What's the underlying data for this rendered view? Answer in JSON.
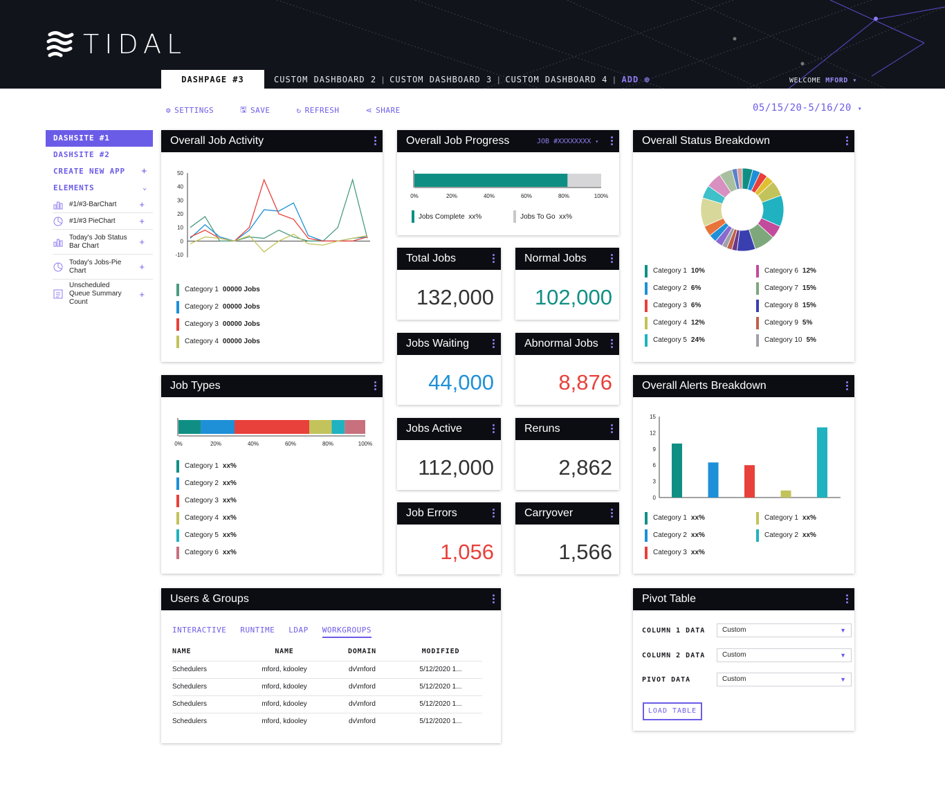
{
  "app": {
    "brand": "TIDAL",
    "accent": "#6b5ce7"
  },
  "tabs": {
    "active": "DASHPAGE #3",
    "items": [
      "CUSTOM DASHBOARD 2",
      "CUSTOM DASHBOARD 3",
      "CUSTOM DASHBOARD 4"
    ],
    "add": "ADD"
  },
  "user": {
    "welcome": "WELCOME",
    "name": "MFORD"
  },
  "toolbar": {
    "settings": "SETTINGS",
    "save": "SAVE",
    "refresh": "REFRESH",
    "share": "SHARE"
  },
  "date_range": "05/15/20-5/16/20",
  "sidebar": {
    "items": [
      "DASHSITE #1",
      "DASHSITE #2",
      "CREATE NEW APP",
      "ELEMENTS"
    ],
    "elements": [
      "#1/#3-BarChart",
      "#1/#3 PieChart",
      "Today's Job Status Bar Chart",
      "Today's Jobs-Pie Chart",
      "Unscheduled Queue Summary Count"
    ]
  },
  "cards": {
    "activity": {
      "title": "Overall Job Activity",
      "legend": [
        {
          "label": "Category 1",
          "value": "00000 Jobs"
        },
        {
          "label": "Category 2",
          "value": "00000 Jobs"
        },
        {
          "label": "Category 3",
          "value": "00000 Jobs"
        },
        {
          "label": "Category 4",
          "value": "00000 Jobs"
        }
      ]
    },
    "progress": {
      "title": "Overall Job Progress",
      "job": "JOB #XXXXXXXX",
      "complete_label": "Jobs Complete",
      "complete_value": "xx%",
      "togo_label": "Jobs To Go",
      "togo_value": "xx%"
    },
    "status": {
      "title": "Overall Status Breakdown"
    },
    "types": {
      "title": "Job Types",
      "legend": [
        {
          "label": "Category 1",
          "value": "xx%"
        },
        {
          "label": "Category 2",
          "value": "xx%"
        },
        {
          "label": "Category 3",
          "value": "xx%"
        },
        {
          "label": "Category 4",
          "value": "xx%"
        },
        {
          "label": "Category 5",
          "value": "xx%"
        },
        {
          "label": "Category 6",
          "value": "xx%"
        }
      ]
    },
    "alerts": {
      "title": "Overall Alerts Breakdown",
      "legend": [
        {
          "label": "Category 1",
          "value": "xx%"
        },
        {
          "label": "Category 2",
          "value": "xx%"
        },
        {
          "label": "Category 3",
          "value": "xx%"
        },
        {
          "label": "Category 1",
          "value": "xx%"
        },
        {
          "label": "Category 2",
          "value": "xx%"
        }
      ]
    },
    "users": {
      "title": "Users & Groups",
      "tabs": [
        "INTERACTIVE",
        "RUNTIME",
        "LDAP",
        "WORKGROUPS"
      ],
      "columns": [
        "NAME",
        "NAME",
        "DOMAIN",
        "MODIFIED"
      ],
      "rows": [
        [
          "Schedulers",
          "mford, kdooley",
          "dv\\mford",
          "5/12/2020 1..."
        ],
        [
          "Schedulers",
          "mford, kdooley",
          "dv\\mford",
          "5/12/2020 1..."
        ],
        [
          "Schedulers",
          "mford, kdooley",
          "dv\\mford",
          "5/12/2020 1..."
        ],
        [
          "Schedulers",
          "mford, kdooley",
          "dv\\mford",
          "5/12/2020 1..."
        ]
      ]
    },
    "pivot": {
      "title": "Pivot Table",
      "rows": [
        {
          "label": "COLUMN 1 DATA",
          "value": "Custom"
        },
        {
          "label": "COLUMN 2 DATA",
          "value": "Custom"
        },
        {
          "label": "PIVOT DATA",
          "value": "Custom"
        }
      ],
      "button": "LOAD TABLE"
    }
  },
  "stats": [
    {
      "title": "Total Jobs",
      "value": "132,000",
      "color": "#333333"
    },
    {
      "title": "Normal Jobs",
      "value": "102,000",
      "color": "#0f8f84"
    },
    {
      "title": "Jobs Waiting",
      "value": "44,000",
      "color": "#1e90d8"
    },
    {
      "title": "Abnormal Jobs",
      "value": "8,876",
      "color": "#e8403a"
    },
    {
      "title": "Jobs Active",
      "value": "112,000",
      "color": "#333333"
    },
    {
      "title": "Reruns",
      "value": "2,862",
      "color": "#333333"
    },
    {
      "title": "Job Errors",
      "value": "1,056",
      "color": "#e8403a"
    },
    {
      "title": "Carryover",
      "value": "1,566",
      "color": "#333333"
    }
  ],
  "chart_data": [
    {
      "type": "line",
      "x": [
        1,
        2,
        3,
        4,
        5,
        6,
        7,
        8,
        9,
        10,
        11,
        12,
        13
      ],
      "ylim": [
        -10,
        50
      ],
      "yticks": [
        50,
        40,
        30,
        20,
        10,
        0,
        -10
      ],
      "series": [
        {
          "name": "Category 1",
          "color": "#4a9c80",
          "values": [
            10,
            18,
            0,
            0,
            3,
            2,
            8,
            3,
            0,
            0,
            10,
            45,
            2
          ]
        },
        {
          "name": "Category 2",
          "color": "#1e90d8",
          "values": [
            2,
            12,
            3,
            0,
            8,
            23,
            22,
            28,
            4,
            0,
            0,
            2,
            3
          ]
        },
        {
          "name": "Category 3",
          "color": "#e8403a",
          "values": [
            3,
            8,
            2,
            0,
            10,
            45,
            20,
            16,
            2,
            0,
            0,
            0,
            3
          ]
        },
        {
          "name": "Category 4",
          "color": "#c2c35a",
          "values": [
            -2,
            3,
            2,
            0,
            4,
            -8,
            0,
            5,
            -2,
            -3,
            0,
            2,
            4
          ]
        }
      ]
    },
    {
      "type": "bar",
      "orientation": "horizontal",
      "stacked": true,
      "xticks": [
        "0%",
        "20%",
        "40%",
        "60%",
        "80%",
        "100%"
      ],
      "series": [
        {
          "name": "Jobs Complete",
          "color": "#0f8f84",
          "values": [
            82
          ]
        },
        {
          "name": "Jobs To Go",
          "color": "#d6d6d8",
          "values": [
            18
          ]
        }
      ]
    },
    {
      "type": "pie",
      "donut": true,
      "legend": [
        {
          "label": "Category 1",
          "value": "10%",
          "color": "#0f8f84"
        },
        {
          "label": "Category 2",
          "value": "6%",
          "color": "#1e90d8"
        },
        {
          "label": "Category 3",
          "value": "6%",
          "color": "#e8403a"
        },
        {
          "label": "Category 4",
          "value": "12%",
          "color": "#c2c35a"
        },
        {
          "label": "Category 5",
          "value": "24%",
          "color": "#20b2c0"
        },
        {
          "label": "Category 6",
          "value": "12%",
          "color": "#c24b9c"
        },
        {
          "label": "Category 7",
          "value": "15%",
          "color": "#7ea87c"
        },
        {
          "label": "Category 8",
          "value": "15%",
          "color": "#3a3fb0"
        },
        {
          "label": "Category 9",
          "value": "5%",
          "color": "#c0604a"
        },
        {
          "label": "Category 10",
          "value": "5%",
          "color": "#a0a0a8"
        }
      ],
      "slices": [
        {
          "value": 4,
          "color": "#0f8f84"
        },
        {
          "value": 3,
          "color": "#1e90d8"
        },
        {
          "value": 3,
          "color": "#e8403a"
        },
        {
          "value": 3,
          "color": "#e0c030"
        },
        {
          "value": 6,
          "color": "#c2c35a"
        },
        {
          "value": 12,
          "color": "#20b2c0"
        },
        {
          "value": 5,
          "color": "#c24b9c"
        },
        {
          "value": 8,
          "color": "#7ea87c"
        },
        {
          "value": 7,
          "color": "#3a3fb0"
        },
        {
          "value": 2,
          "color": "#6a3a8a"
        },
        {
          "value": 2,
          "color": "#c0604a"
        },
        {
          "value": 2,
          "color": "#a0a0a8"
        },
        {
          "value": 3,
          "color": "#8a6ad0"
        },
        {
          "value": 3,
          "color": "#1e90d8"
        },
        {
          "value": 4,
          "color": "#e8743a"
        },
        {
          "value": 11,
          "color": "#d8d89a"
        },
        {
          "value": 5,
          "color": "#40c0c8"
        },
        {
          "value": 6,
          "color": "#d890c0"
        },
        {
          "value": 5,
          "color": "#a8c0a0"
        },
        {
          "value": 2,
          "color": "#5a80c8"
        },
        {
          "value": 2,
          "color": "#d8a0a0"
        }
      ]
    },
    {
      "type": "bar",
      "orientation": "horizontal",
      "stacked": true,
      "xticks": [
        "0%",
        "20%",
        "40%",
        "60%",
        "80%",
        "100%"
      ],
      "series": [
        {
          "name": "Category 1",
          "color": "#0f8f84",
          "values": [
            12
          ]
        },
        {
          "name": "Category 2",
          "color": "#1e90d8",
          "values": [
            18
          ]
        },
        {
          "name": "Category 3",
          "color": "#e8403a",
          "values": [
            40
          ]
        },
        {
          "name": "Category 4",
          "color": "#c2c35a",
          "values": [
            12
          ]
        },
        {
          "name": "Category 5",
          "color": "#20b2c0",
          "values": [
            7
          ]
        },
        {
          "name": "Category 6",
          "color": "#c8707e",
          "values": [
            11
          ]
        }
      ]
    },
    {
      "type": "bar",
      "ylim": [
        0,
        15
      ],
      "yticks": [
        15,
        12,
        9,
        6,
        3,
        0
      ],
      "series": [
        {
          "name": "Category 1",
          "color": "#0f8f84",
          "values": [
            10
          ]
        },
        {
          "name": "Category 2",
          "color": "#1e90d8",
          "values": [
            6.5
          ]
        },
        {
          "name": "Category 3",
          "color": "#e8403a",
          "values": [
            6
          ]
        },
        {
          "name": "Category 1",
          "color": "#c2c35a",
          "values": [
            1.3
          ]
        },
        {
          "name": "Category 2",
          "color": "#20b2c0",
          "values": [
            13
          ]
        }
      ]
    }
  ]
}
